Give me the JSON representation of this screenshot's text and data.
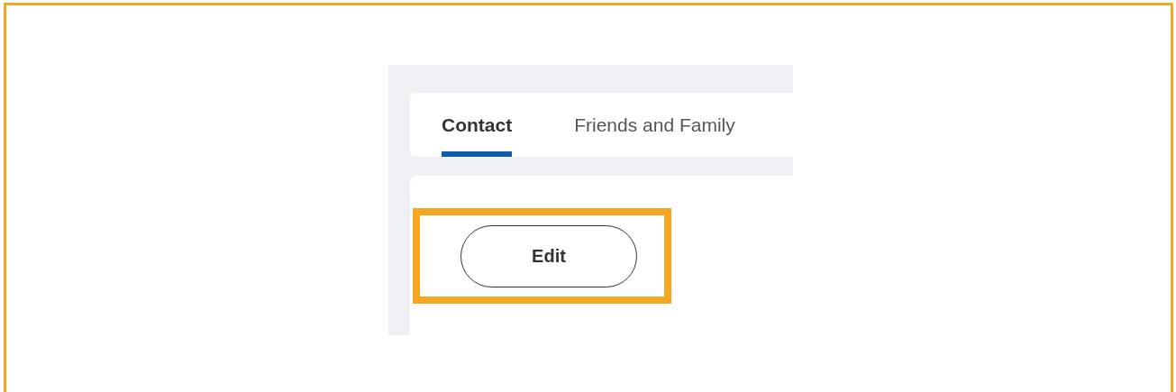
{
  "tabs": [
    {
      "label": "Contact",
      "selected": true
    },
    {
      "label": "Friends and Family",
      "selected": false
    }
  ],
  "buttons": [
    {
      "label": "Edit",
      "highlighted": true
    }
  ]
}
